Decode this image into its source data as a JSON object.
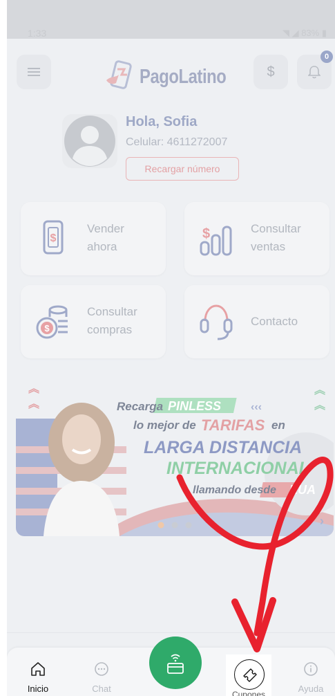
{
  "status": {
    "time": "1:33",
    "right": "◥ ◢ 83% ▮"
  },
  "header": {
    "brand": "PagoLatino",
    "currency_label": "$",
    "notification_count": "0"
  },
  "profile": {
    "greeting": "Hola, Sofia",
    "phone": "Celular: 4611272007",
    "recharge_label": "Recargar número"
  },
  "actions": [
    {
      "label": "Vender\nahora",
      "icon": "cash-phone-icon"
    },
    {
      "label": "Consultar\nventas",
      "icon": "sales-chart-icon"
    },
    {
      "label": "Consultar\ncompras",
      "icon": "coins-icon"
    },
    {
      "label": "Contacto",
      "icon": "headset-icon"
    }
  ],
  "banner": {
    "line1a": "Recarga",
    "line1b": "PINLESS",
    "line2a": "lo mejor de",
    "line2b": "TARIFAS",
    "line2c": "en",
    "line3": "LARGA DISTANCIA",
    "line4": "INTERNACIONAL",
    "line5a": "llamando desde",
    "line5b": "EUA",
    "active_slide": 0,
    "slide_count": 3
  },
  "bottom_nav": {
    "home": "Inicio",
    "chat": "Chat",
    "coupons": "Cupones",
    "help": "Ayuda"
  },
  "colors": {
    "brand_red": "#e53935",
    "brand_blue": "#3b4fa8",
    "fab_green": "#2faa6a",
    "annotation_red": "#e8222e"
  }
}
